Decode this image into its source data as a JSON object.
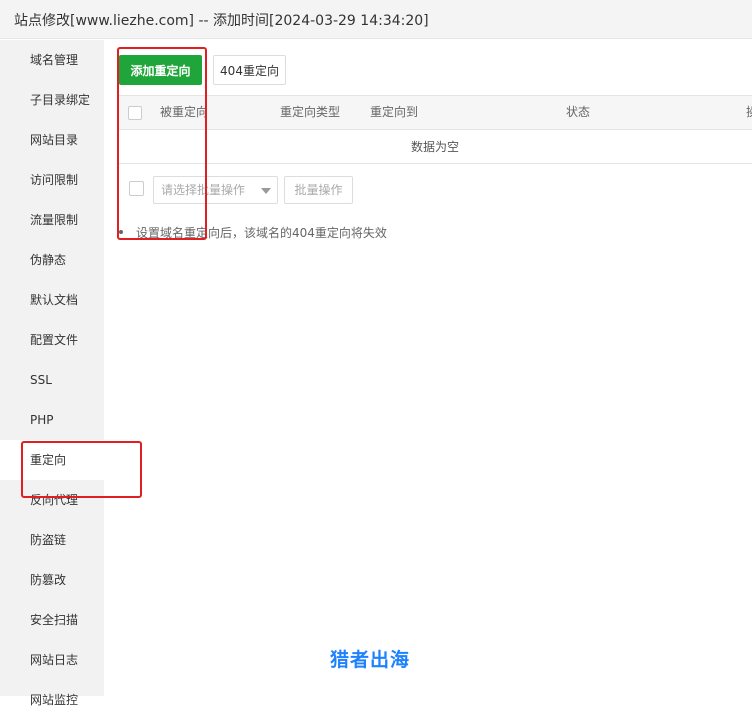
{
  "window": {
    "title": "站点修改[www.liezhe.com] -- 添加时间[2024-03-29 14:34:20]"
  },
  "sidebar": {
    "items": [
      {
        "label": "域名管理"
      },
      {
        "label": "子目录绑定"
      },
      {
        "label": "网站目录"
      },
      {
        "label": "访问限制"
      },
      {
        "label": "流量限制"
      },
      {
        "label": "伪静态"
      },
      {
        "label": "默认文档"
      },
      {
        "label": "配置文件"
      },
      {
        "label": "SSL"
      },
      {
        "label": "PHP"
      },
      {
        "label": "重定向"
      },
      {
        "label": "反向代理"
      },
      {
        "label": "防盗链"
      },
      {
        "label": "防篡改"
      },
      {
        "label": "安全扫描"
      },
      {
        "label": "网站日志"
      },
      {
        "label": "网站监控"
      }
    ],
    "active": "重定向"
  },
  "toolbar": {
    "add_label": "添加重定向",
    "redirect404_label": "404重定向"
  },
  "table": {
    "columns": [
      "被重定向",
      "重定向类型",
      "重定向到",
      "状态",
      "操作"
    ],
    "empty_text": "数据为空"
  },
  "batch": {
    "select_placeholder": "请选择批量操作",
    "button_label": "批量操作"
  },
  "tips": [
    "设置域名重定向后，该域名的404重定向将失效"
  ],
  "watermark": "猎者出海",
  "colors": {
    "accent": "#20a53a",
    "highlight": "#e02020",
    "watermark": "#1e82ff"
  }
}
